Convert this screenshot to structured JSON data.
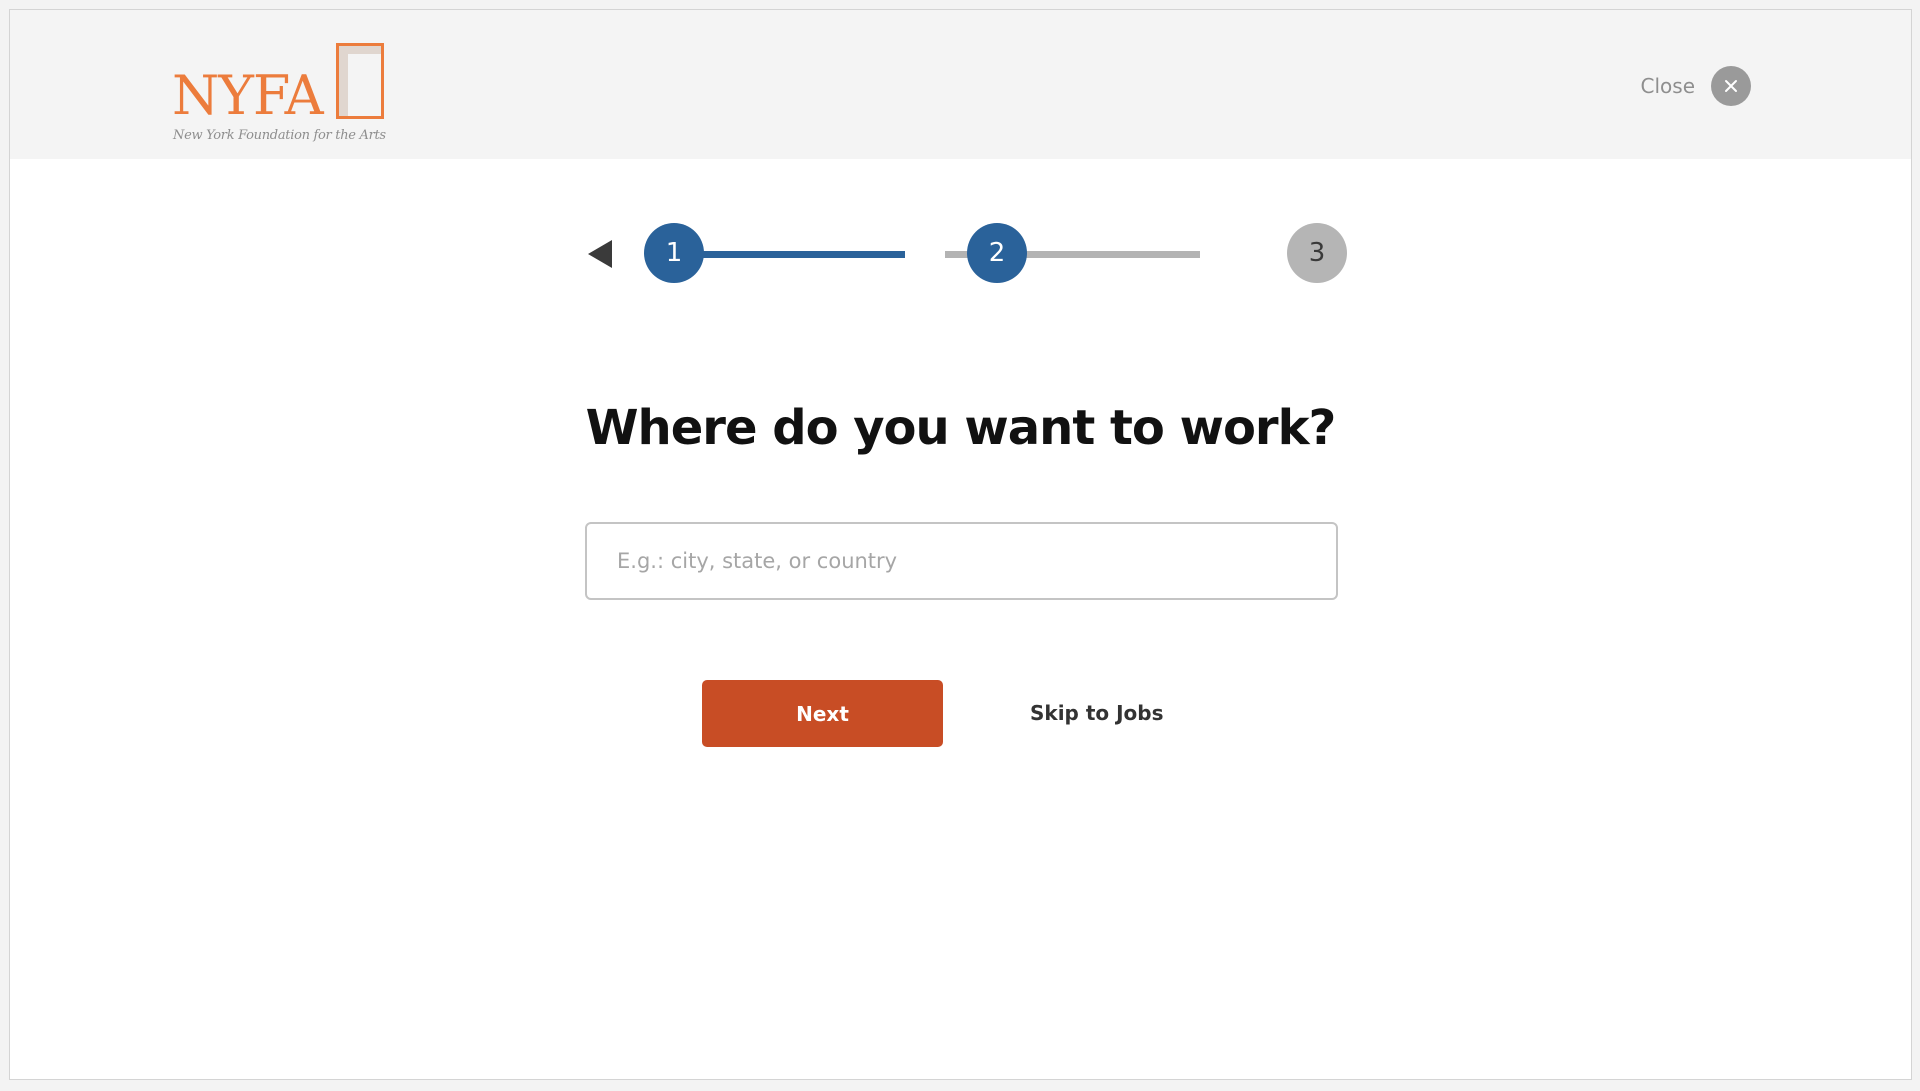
{
  "header": {
    "logo_text": "NYFA",
    "logo_subtitle": "New York Foundation for the Arts",
    "close_label": "Close"
  },
  "stepper": {
    "steps": [
      "1",
      "2",
      "3"
    ],
    "current_step": 2,
    "total_steps": 3
  },
  "main": {
    "question": "Where do you want to work?",
    "location_placeholder": "E.g.: city, state, or country",
    "location_value": "",
    "next_label": "Next",
    "skip_label": "Skip to Jobs"
  },
  "colors": {
    "accent_blue": "#2a629a",
    "accent_orange": "#c84d25",
    "brand_orange": "#ec7c3c",
    "inactive_gray": "#b5b5b5"
  }
}
